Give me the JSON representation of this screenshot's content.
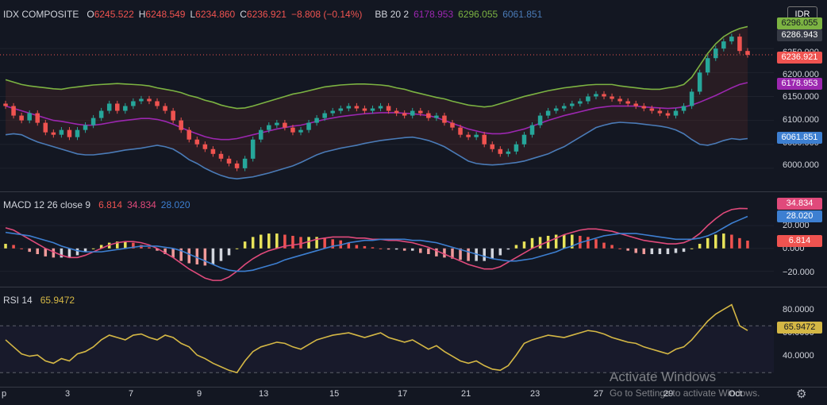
{
  "currency_button": "IDR",
  "main": {
    "symbol": "IDX COMPOSITE",
    "o_label": "O",
    "o_value": "6245.522",
    "h_label": "H",
    "h_value": "6248.549",
    "l_label": "L",
    "l_value": "6234.860",
    "c_label": "C",
    "c_value": "6236.921",
    "change": "−8.808 (−0.14%)",
    "bb_label": "BB 20 2",
    "bb_basis": "6178.953",
    "bb_upper": "6296.055",
    "bb_lower": "6061.851",
    "ticks": [
      "6250.000",
      "6200.000",
      "6150.000",
      "6100.000",
      "6050.000",
      "6000.000"
    ],
    "tags": {
      "upper_hidden": "6296.055",
      "high": "6286.943",
      "price": "6236.921",
      "basis": "6178.953",
      "lower": "6061.851"
    }
  },
  "macd": {
    "label": "MACD 12 26 close 9",
    "hist": "6.814",
    "macd": "34.834",
    "signal": "28.020",
    "ticks": [
      "20.000",
      "0.000",
      "−20.000"
    ]
  },
  "rsi": {
    "label": "RSI 14",
    "value": "65.9472",
    "ticks": [
      "80.0000",
      "60.0000",
      "40.0000"
    ]
  },
  "x_axis": [
    "p",
    "3",
    "7",
    "9",
    "13",
    "15",
    "17",
    "21",
    "23",
    "27",
    "29",
    "Oct"
  ],
  "watermark": {
    "title": "Activate Windows",
    "subtitle": "Go to Settings to activate Windows."
  },
  "colors": {
    "up": "#26a69a",
    "down": "#ef5350",
    "basis": "#9c27b0",
    "upper": "#7cb342",
    "lower": "#4a7bb7",
    "macd_line": "#e04a7b",
    "signal_line": "#3d7fd1",
    "rsi_line": "#d4b745",
    "price_tag": "#ef5350",
    "high_tag": "#363a45",
    "upper_tag": "#7cb342",
    "basis_tag": "#9c27b0",
    "lower_tag": "#3d7fd1",
    "macd_tag": "#e04a7b",
    "signal_tag": "#3d7fd1",
    "hist_tag": "#ef5350",
    "rsi_tag": "#d4b745"
  },
  "chart_data": [
    {
      "type": "candlestick",
      "title": "IDX COMPOSITE",
      "ylim": [
        5960,
        6310
      ],
      "closes": [
        6130,
        6110,
        6100,
        6115,
        6095,
        6075,
        6070,
        6080,
        6065,
        6080,
        6090,
        6105,
        6120,
        6135,
        6120,
        6130,
        6140,
        6145,
        6140,
        6130,
        6120,
        6100,
        6080,
        6060,
        6050,
        6040,
        6030,
        6020,
        6010,
        6000,
        6020,
        6060,
        6080,
        6090,
        6095,
        6085,
        6075,
        6080,
        6095,
        6105,
        6115,
        6120,
        6125,
        6130,
        6125,
        6120,
        6125,
        6130,
        6120,
        6115,
        6110,
        6120,
        6115,
        6105,
        6110,
        6095,
        6085,
        6070,
        6065,
        6070,
        6050,
        6040,
        6030,
        6035,
        6050,
        6070,
        6090,
        6110,
        6120,
        6125,
        6130,
        6135,
        6140,
        6150,
        6155,
        6150,
        6145,
        6140,
        6135,
        6130,
        6125,
        6120,
        6115,
        6110,
        6120,
        6130,
        6160,
        6200,
        6230,
        6250,
        6265,
        6275,
        6245,
        6237
      ],
      "bb": {
        "basis": [
          6130,
          6125,
          6120,
          6115,
          6110,
          6105,
          6100,
          6098,
          6095,
          6092,
          6090,
          6090,
          6092,
          6095,
          6098,
          6100,
          6102,
          6104,
          6104,
          6102,
          6098,
          6092,
          6085,
          6078,
          6072,
          6066,
          6062,
          6060,
          6060,
          6062,
          6066,
          6070,
          6074,
          6078,
          6082,
          6085,
          6088,
          6090,
          6094,
          6098,
          6102,
          6105,
          6108,
          6110,
          6112,
          6114,
          6115,
          6116,
          6116,
          6116,
          6115,
          6114,
          6112,
          6110,
          6106,
          6100,
          6094,
          6088,
          6082,
          6078,
          6074,
          6072,
          6072,
          6074,
          6078,
          6082,
          6088,
          6094,
          6100,
          6105,
          6110,
          6114,
          6118,
          6122,
          6126,
          6128,
          6130,
          6130,
          6130,
          6130,
          6128,
          6127,
          6126,
          6125,
          6126,
          6128,
          6132,
          6138,
          6145,
          6152,
          6160,
          6168,
          6175,
          6179
        ],
        "upper": [
          6185,
          6180,
          6175,
          6172,
          6170,
          6168,
          6166,
          6165,
          6168,
          6170,
          6172,
          6174,
          6175,
          6176,
          6177,
          6176,
          6175,
          6174,
          6172,
          6168,
          6165,
          6162,
          6158,
          6152,
          6148,
          6142,
          6138,
          6132,
          6128,
          6125,
          6126,
          6130,
          6135,
          6140,
          6145,
          6150,
          6155,
          6158,
          6162,
          6166,
          6170,
          6172,
          6174,
          6175,
          6176,
          6176,
          6175,
          6174,
          6172,
          6168,
          6165,
          6160,
          6156,
          6152,
          6148,
          6145,
          6140,
          6136,
          6132,
          6130,
          6128,
          6130,
          6135,
          6140,
          6145,
          6150,
          6154,
          6158,
          6162,
          6165,
          6168,
          6170,
          6172,
          6174,
          6175,
          6175,
          6175,
          6172,
          6170,
          6168,
          6166,
          6165,
          6165,
          6168,
          6170,
          6175,
          6190,
          6215,
          6240,
          6260,
          6275,
          6285,
          6292,
          6296
        ],
        "lower": [
          6070,
          6072,
          6070,
          6062,
          6055,
          6050,
          6045,
          6040,
          6035,
          6030,
          6028,
          6028,
          6030,
          6032,
          6035,
          6038,
          6040,
          6042,
          6045,
          6048,
          6045,
          6040,
          6030,
          6018,
          6010,
          6000,
          5992,
          5985,
          5980,
          5978,
          5980,
          5982,
          5986,
          5990,
          5995,
          6000,
          6005,
          6012,
          6020,
          6028,
          6034,
          6038,
          6042,
          6045,
          6048,
          6052,
          6055,
          6058,
          6060,
          6062,
          6064,
          6065,
          6062,
          6058,
          6052,
          6045,
          6035,
          6025,
          6015,
          6010,
          6008,
          6007,
          6008,
          6010,
          6012,
          6015,
          6020,
          6025,
          6030,
          6038,
          6045,
          6055,
          6065,
          6075,
          6085,
          6090,
          6094,
          6096,
          6095,
          6094,
          6092,
          6090,
          6088,
          6085,
          6080,
          6072,
          6060,
          6050,
          6048,
          6052,
          6058,
          6062,
          6060,
          6062
        ]
      }
    },
    {
      "type": "line",
      "title": "MACD 12 26 close 9",
      "ylim": [
        -30,
        45
      ],
      "series": [
        {
          "name": "MACD",
          "values": [
            18,
            16,
            12,
            8,
            4,
            0,
            -3,
            -6,
            -8,
            -8,
            -6,
            -3,
            0,
            3,
            5,
            6,
            6,
            5,
            3,
            0,
            -4,
            -8,
            -13,
            -18,
            -22,
            -26,
            -28,
            -28,
            -25,
            -20,
            -14,
            -9,
            -5,
            -2,
            0,
            2,
            3,
            4,
            6,
            8,
            9,
            10,
            10,
            10,
            9,
            9,
            8,
            8,
            7,
            7,
            6,
            5,
            3,
            1,
            -2,
            -5,
            -8,
            -11,
            -14,
            -16,
            -18,
            -18,
            -16,
            -12,
            -8,
            -4,
            0,
            3,
            6,
            9,
            12,
            14,
            16,
            17,
            17,
            16,
            15,
            13,
            11,
            9,
            7,
            6,
            5,
            4,
            4,
            5,
            8,
            13,
            20,
            26,
            31,
            34,
            35,
            34.8
          ]
        },
        {
          "name": "Signal",
          "values": [
            14,
            13,
            12,
            11,
            9,
            7,
            5,
            2,
            0,
            -2,
            -3,
            -3,
            -3,
            -2,
            -1,
            0,
            1,
            2,
            2,
            2,
            1,
            0,
            -2,
            -5,
            -8,
            -11,
            -14,
            -17,
            -19,
            -20,
            -20,
            -19,
            -17,
            -15,
            -13,
            -10,
            -8,
            -6,
            -4,
            -2,
            0,
            2,
            3,
            5,
            6,
            7,
            7,
            8,
            8,
            8,
            8,
            7,
            7,
            6,
            5,
            3,
            1,
            -1,
            -3,
            -5,
            -7,
            -9,
            -10,
            -11,
            -11,
            -10,
            -9,
            -7,
            -5,
            -3,
            0,
            2,
            5,
            7,
            9,
            11,
            12,
            13,
            13,
            13,
            12,
            11,
            10,
            9,
            8,
            8,
            8,
            9,
            11,
            14,
            18,
            22,
            25,
            28
          ]
        }
      ],
      "histogram": [
        4,
        3,
        0,
        -3,
        -5,
        -7,
        -8,
        -8,
        -8,
        -6,
        -3,
        0,
        3,
        5,
        6,
        6,
        5,
        3,
        1,
        -2,
        -5,
        -8,
        -11,
        -13,
        -14,
        -15,
        -14,
        -11,
        -6,
        0,
        6,
        10,
        12,
        13,
        13,
        12,
        11,
        10,
        10,
        10,
        9,
        8,
        7,
        5,
        3,
        2,
        1,
        0,
        -1,
        -1,
        -2,
        -2,
        -4,
        -5,
        -7,
        -8,
        -9,
        -10,
        -11,
        -11,
        -11,
        -9,
        -6,
        -1,
        3,
        6,
        9,
        10,
        11,
        12,
        12,
        12,
        11,
        10,
        8,
        5,
        3,
        0,
        -2,
        -4,
        -5,
        -5,
        -5,
        -5,
        -4,
        -3,
        0,
        4,
        9,
        12,
        13,
        12,
        9,
        6.8
      ]
    },
    {
      "type": "line",
      "title": "RSI 14",
      "ylim": [
        20,
        100
      ],
      "series": [
        {
          "name": "RSI",
          "values": [
            58,
            52,
            46,
            44,
            45,
            40,
            38,
            42,
            40,
            46,
            48,
            52,
            58,
            62,
            60,
            58,
            62,
            63,
            60,
            58,
            62,
            60,
            55,
            52,
            45,
            42,
            38,
            35,
            32,
            30,
            40,
            48,
            52,
            54,
            56,
            55,
            52,
            50,
            54,
            58,
            60,
            62,
            63,
            64,
            62,
            60,
            62,
            64,
            60,
            58,
            56,
            58,
            54,
            50,
            53,
            48,
            44,
            40,
            38,
            40,
            36,
            33,
            32,
            36,
            45,
            55,
            58,
            60,
            62,
            61,
            60,
            62,
            64,
            66,
            65,
            63,
            60,
            58,
            56,
            55,
            52,
            50,
            48,
            46,
            50,
            52,
            58,
            66,
            74,
            80,
            84,
            88,
            70,
            66
          ]
        }
      ]
    }
  ]
}
